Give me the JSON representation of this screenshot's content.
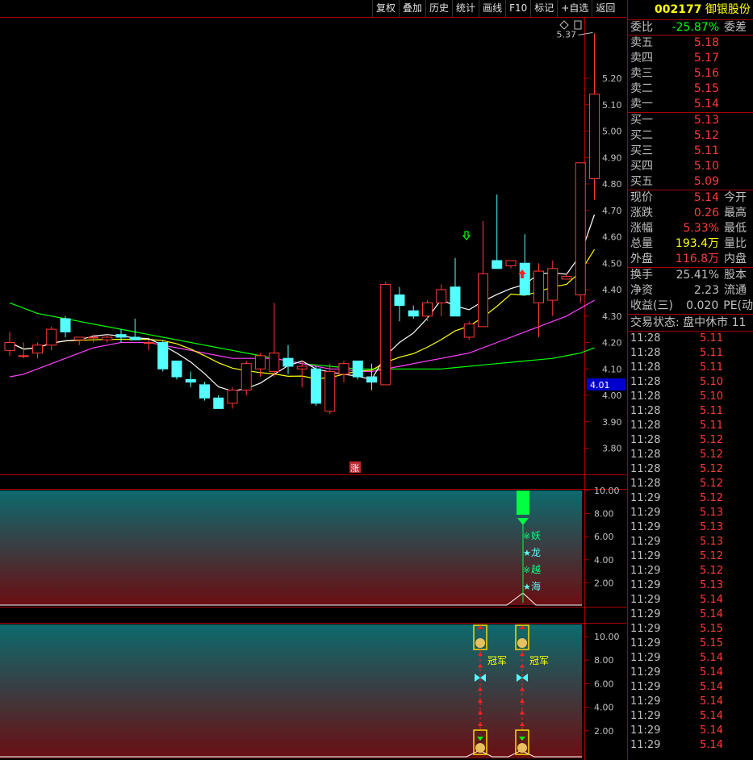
{
  "toolbar": {
    "items": [
      "复权",
      "叠加",
      "历史",
      "统计",
      "画线",
      "F10",
      "标记",
      "+自选",
      "返回"
    ]
  },
  "chart": {
    "high_label": "5.37",
    "current_price_tag": "4.01",
    "zhang_label": "涨",
    "price_axis": [
      "5.20",
      "5.10",
      "5.00",
      "4.90",
      "4.80",
      "4.70",
      "4.60",
      "4.50",
      "4.40",
      "4.30",
      "4.20",
      "4.10",
      "4.00",
      "3.90",
      "3.80"
    ],
    "ind1_axis": [
      "10.00",
      "8.00",
      "6.00",
      "4.00",
      "2.00"
    ],
    "ind2_axis": [
      "10.00",
      "8.00",
      "6.00",
      "4.00",
      "2.00"
    ],
    "ind1_labels": [
      "妖",
      "龙",
      "越",
      "海"
    ],
    "champion_label": "冠军",
    "colors": {
      "up": "#ff3b3b",
      "down": "#54ffff",
      "ma5": "#ffffff",
      "ma10": "#ffff00",
      "ma20": "#ff40ff",
      "ma60": "#00ff00"
    }
  },
  "quote": {
    "code": "002177",
    "name": "御银股份",
    "weibi": {
      "label": "委比",
      "value": "-25.87%",
      "extra": "委差"
    },
    "asks": [
      {
        "label": "卖五",
        "price": "5.18"
      },
      {
        "label": "卖四",
        "price": "5.17"
      },
      {
        "label": "卖三",
        "price": "5.16"
      },
      {
        "label": "卖二",
        "price": "5.15"
      },
      {
        "label": "卖一",
        "price": "5.14"
      }
    ],
    "bids": [
      {
        "label": "买一",
        "price": "5.13"
      },
      {
        "label": "买二",
        "price": "5.12"
      },
      {
        "label": "买三",
        "price": "5.11"
      },
      {
        "label": "买四",
        "price": "5.10"
      },
      {
        "label": "买五",
        "price": "5.09"
      }
    ],
    "stats": [
      {
        "label": "现价",
        "value": "5.14",
        "extra": "今开"
      },
      {
        "label": "涨跌",
        "value": "0.26",
        "extra": "最高"
      },
      {
        "label": "涨幅",
        "value": "5.33%",
        "extra": "最低"
      },
      {
        "label": "总量",
        "value": "193.4万",
        "extra": "量比"
      },
      {
        "label": "外盘",
        "value": "116.8万",
        "extra": "内盘"
      }
    ],
    "stats2": [
      {
        "label": "换手",
        "value": "25.41%",
        "extra": "股本"
      },
      {
        "label": "净资",
        "value": "2.23",
        "extra": "流通"
      },
      {
        "label": "收益(三)",
        "value": "0.020",
        "extra": "PE(动"
      }
    ],
    "status": "交易状态: 盘中休市 11",
    "ticks": [
      {
        "time": "11:28",
        "price": "5.11"
      },
      {
        "time": "11:28",
        "price": "5.11"
      },
      {
        "time": "11:28",
        "price": "5.11"
      },
      {
        "time": "11:28",
        "price": "5.10"
      },
      {
        "time": "11:28",
        "price": "5.10"
      },
      {
        "time": "11:28",
        "price": "5.11"
      },
      {
        "time": "11:28",
        "price": "5.11"
      },
      {
        "time": "11:28",
        "price": "5.12"
      },
      {
        "time": "11:28",
        "price": "5.12"
      },
      {
        "time": "11:28",
        "price": "5.12"
      },
      {
        "time": "11:28",
        "price": "5.12"
      },
      {
        "time": "11:29",
        "price": "5.12"
      },
      {
        "time": "11:29",
        "price": "5.13"
      },
      {
        "time": "11:29",
        "price": "5.13"
      },
      {
        "time": "11:29",
        "price": "5.13"
      },
      {
        "time": "11:29",
        "price": "5.12"
      },
      {
        "time": "11:29",
        "price": "5.12"
      },
      {
        "time": "11:29",
        "price": "5.13"
      },
      {
        "time": "11:29",
        "price": "5.14"
      },
      {
        "time": "11:29",
        "price": "5.14"
      },
      {
        "time": "11:29",
        "price": "5.15"
      },
      {
        "time": "11:29",
        "price": "5.15"
      },
      {
        "time": "11:29",
        "price": "5.14"
      },
      {
        "time": "11:29",
        "price": "5.14"
      },
      {
        "time": "11:29",
        "price": "5.14"
      },
      {
        "time": "11:29",
        "price": "5.14"
      },
      {
        "time": "11:29",
        "price": "5.14"
      },
      {
        "time": "11:29",
        "price": "5.14"
      },
      {
        "time": "11:29",
        "price": "5.14"
      }
    ]
  },
  "candles": [
    {
      "o": 4.17,
      "h": 4.24,
      "l": 4.15,
      "c": 4.2
    },
    {
      "o": 4.15,
      "h": 4.2,
      "l": 4.14,
      "c": 4.15
    },
    {
      "o": 4.16,
      "h": 4.2,
      "l": 4.14,
      "c": 4.19
    },
    {
      "o": 4.19,
      "h": 4.26,
      "l": 4.17,
      "c": 4.25
    },
    {
      "o": 4.29,
      "h": 4.3,
      "l": 4.22,
      "c": 4.24
    },
    {
      "o": 4.21,
      "h": 4.22,
      "l": 4.19,
      "c": 4.22
    },
    {
      "o": 4.22,
      "h": 4.23,
      "l": 4.2,
      "c": 4.22
    },
    {
      "o": 4.21,
      "h": 4.23,
      "l": 4.2,
      "c": 4.22
    },
    {
      "o": 4.23,
      "h": 4.25,
      "l": 4.2,
      "c": 4.22
    },
    {
      "o": 4.22,
      "h": 4.29,
      "l": 4.21,
      "c": 4.21
    },
    {
      "o": 4.2,
      "h": 4.21,
      "l": 4.17,
      "c": 4.2
    },
    {
      "o": 4.2,
      "h": 4.21,
      "l": 4.09,
      "c": 4.1
    },
    {
      "o": 4.13,
      "h": 4.13,
      "l": 4.06,
      "c": 4.07
    },
    {
      "o": 4.06,
      "h": 4.09,
      "l": 4.03,
      "c": 4.05
    },
    {
      "o": 4.04,
      "h": 4.05,
      "l": 3.98,
      "c": 3.99
    },
    {
      "o": 3.99,
      "h": 4.0,
      "l": 3.95,
      "c": 3.95
    },
    {
      "o": 3.97,
      "h": 4.03,
      "l": 3.95,
      "c": 4.02
    },
    {
      "o": 4.02,
      "h": 4.13,
      "l": 4.0,
      "c": 4.12
    },
    {
      "o": 4.1,
      "h": 4.16,
      "l": 4.07,
      "c": 4.15
    },
    {
      "o": 4.09,
      "h": 4.35,
      "l": 4.07,
      "c": 4.16
    },
    {
      "o": 4.14,
      "h": 4.19,
      "l": 4.08,
      "c": 4.11
    },
    {
      "o": 4.1,
      "h": 4.13,
      "l": 4.03,
      "c": 4.11
    },
    {
      "o": 4.1,
      "h": 4.11,
      "l": 3.96,
      "c": 3.97
    },
    {
      "o": 3.94,
      "h": 4.12,
      "l": 3.93,
      "c": 4.09
    },
    {
      "o": 4.08,
      "h": 4.13,
      "l": 4.05,
      "c": 4.12
    },
    {
      "o": 4.13,
      "h": 4.13,
      "l": 4.06,
      "c": 4.07
    },
    {
      "o": 4.07,
      "h": 4.12,
      "l": 4.02,
      "c": 4.05
    },
    {
      "o": 4.04,
      "h": 4.43,
      "l": 4.04,
      "c": 4.42
    },
    {
      "o": 4.38,
      "h": 4.41,
      "l": 4.28,
      "c": 4.34
    },
    {
      "o": 4.32,
      "h": 4.34,
      "l": 4.29,
      "c": 4.3
    },
    {
      "o": 4.3,
      "h": 4.36,
      "l": 4.28,
      "c": 4.35
    },
    {
      "o": 4.35,
      "h": 4.42,
      "l": 4.3,
      "c": 4.4
    },
    {
      "o": 4.41,
      "h": 4.52,
      "l": 4.3,
      "c": 4.3
    },
    {
      "o": 4.22,
      "h": 4.28,
      "l": 4.21,
      "c": 4.27
    },
    {
      "o": 4.26,
      "h": 4.66,
      "l": 4.26,
      "c": 4.46
    },
    {
      "o": 4.51,
      "h": 4.76,
      "l": 4.48,
      "c": 4.48
    },
    {
      "o": 4.49,
      "h": 4.51,
      "l": 4.48,
      "c": 4.51
    },
    {
      "o": 4.5,
      "h": 4.61,
      "l": 4.39,
      "c": 4.38
    },
    {
      "o": 4.35,
      "h": 4.5,
      "l": 4.22,
      "c": 4.47
    },
    {
      "o": 4.36,
      "h": 4.51,
      "l": 4.3,
      "c": 4.48
    },
    {
      "o": 4.44,
      "h": 4.46,
      "l": 4.44,
      "c": 4.45
    },
    {
      "o": 4.38,
      "h": 4.88,
      "l": 4.35,
      "c": 4.88
    },
    {
      "o": 4.82,
      "h": 5.37,
      "l": 4.74,
      "c": 5.14
    }
  ]
}
